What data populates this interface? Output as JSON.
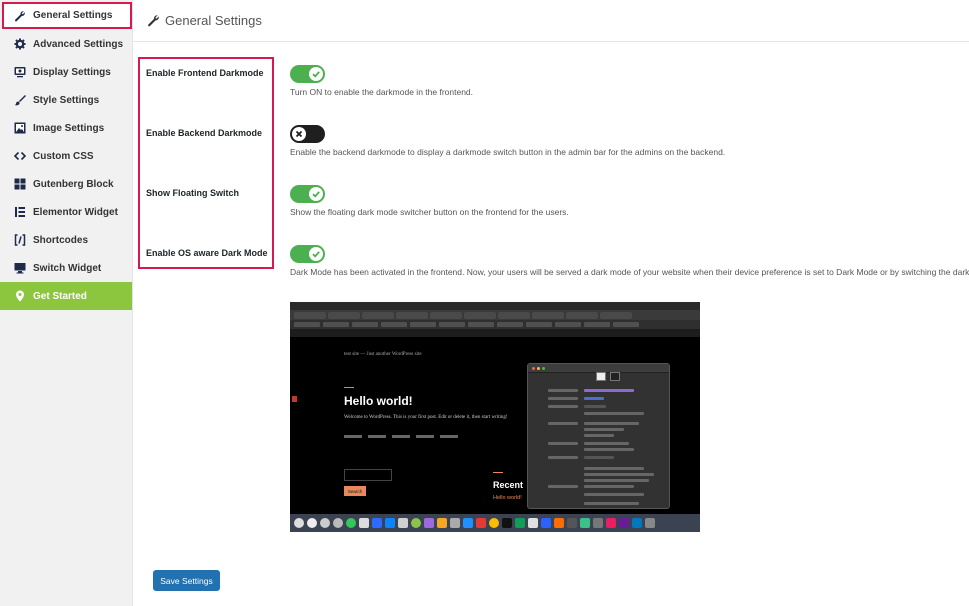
{
  "sidebar": {
    "items": [
      {
        "label": "General Settings",
        "icon": "wrench-icon"
      },
      {
        "label": "Advanced Settings",
        "icon": "gear-icon"
      },
      {
        "label": "Display Settings",
        "icon": "monitor-icon"
      },
      {
        "label": "Style Settings",
        "icon": "brush-icon"
      },
      {
        "label": "Image Settings",
        "icon": "image-icon"
      },
      {
        "label": "Custom CSS",
        "icon": "code-icon"
      },
      {
        "label": "Gutenberg Block",
        "icon": "blocks-icon"
      },
      {
        "label": "Elementor Widget",
        "icon": "elementor-icon"
      },
      {
        "label": "Shortcodes",
        "icon": "shortcode-icon"
      },
      {
        "label": "Switch Widget",
        "icon": "screen-icon"
      },
      {
        "label": "Get Started",
        "icon": "location-pin-icon"
      }
    ]
  },
  "header": {
    "title": "General Settings",
    "icon": "wrench-icon"
  },
  "settings": [
    {
      "label": "Enable Frontend Darkmode",
      "enabled": true,
      "description": "Turn ON to enable the darkmode in the frontend."
    },
    {
      "label": "Enable Backend Darkmode",
      "enabled": false,
      "description": "Enable the backend darkmode to display a darkmode switch button in the admin bar for the admins on the backend."
    },
    {
      "label": "Show Floating Switch",
      "enabled": true,
      "description": "Show the floating dark mode switcher button on the frontend for the users."
    },
    {
      "label": "Enable OS aware Dark Mode",
      "enabled": true,
      "description": "Dark Mode has been activated in the frontend. Now, your users will be served a dark mode of your website when their device preference is set to Dark Mode or by switching the dark mode switch button."
    }
  ],
  "preview": {
    "site_tagline": "test site — Just another WordPress site",
    "post_title": "Hello world!",
    "post_excerpt": "Welcome to WordPress. This is your first post. Edit or delete it, then start writing!",
    "search_button": "Search",
    "recent_heading": "Recent",
    "recent_link": "Hello world!"
  },
  "actions": {
    "save_label": "Save Settings"
  },
  "colors": {
    "accent_highlight": "#d6194f",
    "toggle_on": "#4caf50",
    "toggle_off": "#1f1f1f",
    "primary_button": "#2271b1",
    "get_started": "#8cc63f"
  }
}
